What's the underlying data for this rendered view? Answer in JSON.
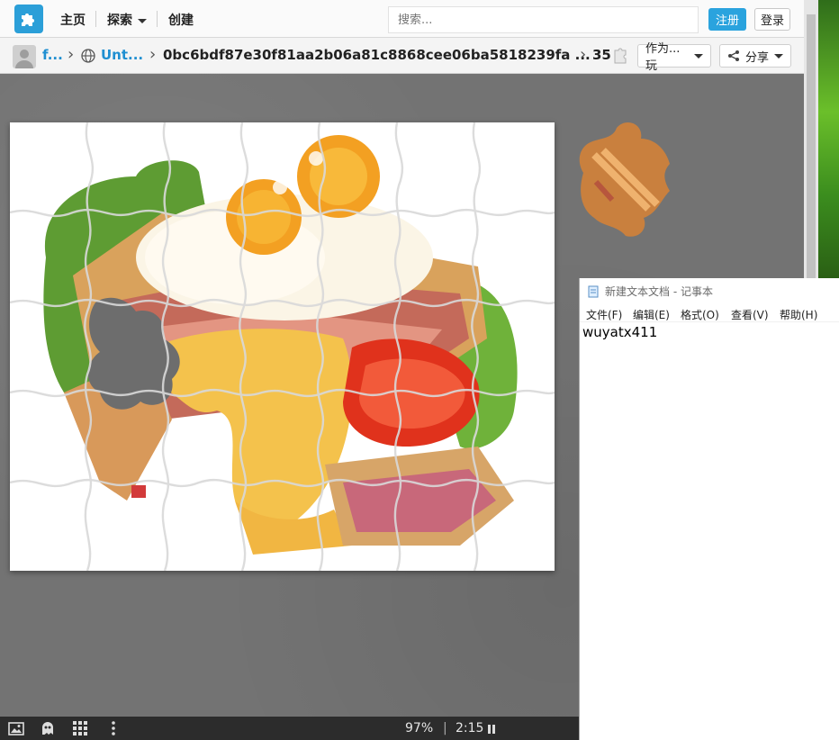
{
  "nav": {
    "home": "主页",
    "explore": "探索",
    "create": "创建",
    "search_placeholder": "搜索...",
    "register": "注册",
    "login": "登录"
  },
  "breadcrumb": {
    "user": "f...",
    "album": "Unt...",
    "puzzle_id": "0bc6bdf87e30f81aa2b06a81c8868cee06ba5818239fa ...",
    "piece_count": "35",
    "play_as": "作为...玩",
    "share": "分享"
  },
  "status": {
    "progress": "97%",
    "separator": "|",
    "timer": "2:15"
  },
  "notepad": {
    "title": "新建文本文档 - 记事本",
    "menu": [
      "文件(F)",
      "编辑(E)",
      "格式(O)",
      "查看(V)",
      "帮助(H)"
    ],
    "content": "wuyatx411"
  },
  "icons": {
    "logo": "puzzle-piece-icon",
    "globe": "globe-icon",
    "puzzle_small": "puzzle-piece-icon",
    "share": "share-icon",
    "image": "image-icon",
    "ghost": "ghost-image-icon",
    "grid": "grid-icon",
    "more": "more-vertical-icon",
    "pause": "pause-icon"
  },
  "colors": {
    "accent": "#2aa3de",
    "link": "#1f8fd1",
    "stage": "#737373"
  }
}
